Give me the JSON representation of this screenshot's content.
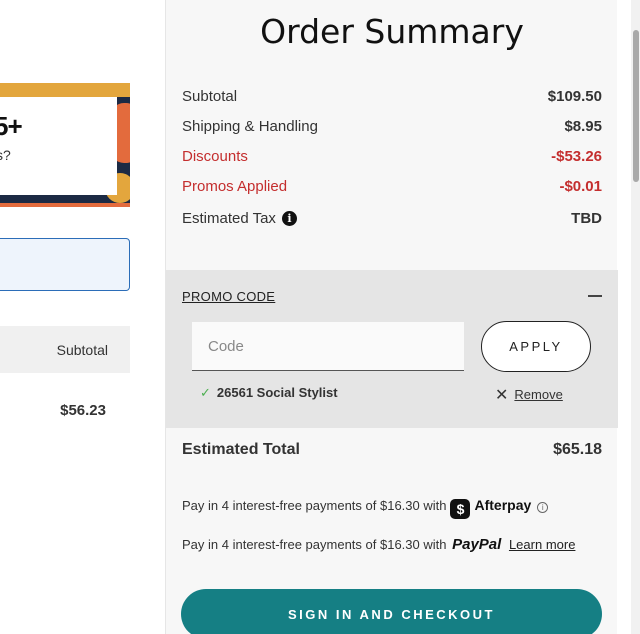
{
  "left": {
    "promo_big": "5+",
    "promo_small": "s?",
    "column_header": "Subtotal",
    "amount": "$56.23"
  },
  "summary": {
    "title": "Order Summary",
    "rows": [
      {
        "label": "Subtotal",
        "value": "$109.50"
      },
      {
        "label": "Shipping & Handling",
        "value": "$8.95"
      },
      {
        "label": "Discounts",
        "value": "-$53.26"
      },
      {
        "label": "Promos Applied",
        "value": "-$0.01"
      },
      {
        "label": "Estimated Tax",
        "value": "TBD"
      }
    ],
    "info_icon_glyph": "i"
  },
  "promo": {
    "title": "PROMO CODE",
    "placeholder": "Code",
    "apply_label": "APPLY",
    "applied_code": "26561 Social Stylist",
    "remove_label": "Remove"
  },
  "total": {
    "label": "Estimated Total",
    "value": "$65.18"
  },
  "afterpay": {
    "text": "Pay in 4 interest-free payments of $16.30 with",
    "brand": "Afterpay",
    "logo_glyph": "$"
  },
  "paypal": {
    "text": "Pay in 4 interest-free payments of $16.30 with",
    "brand": "PayPal",
    "learn_more": "Learn more"
  },
  "checkout": {
    "label": "SIGN IN AND CHECKOUT"
  },
  "colors": {
    "accent": "#157f84",
    "discount": "#c42e2e",
    "check": "#4caf50"
  }
}
